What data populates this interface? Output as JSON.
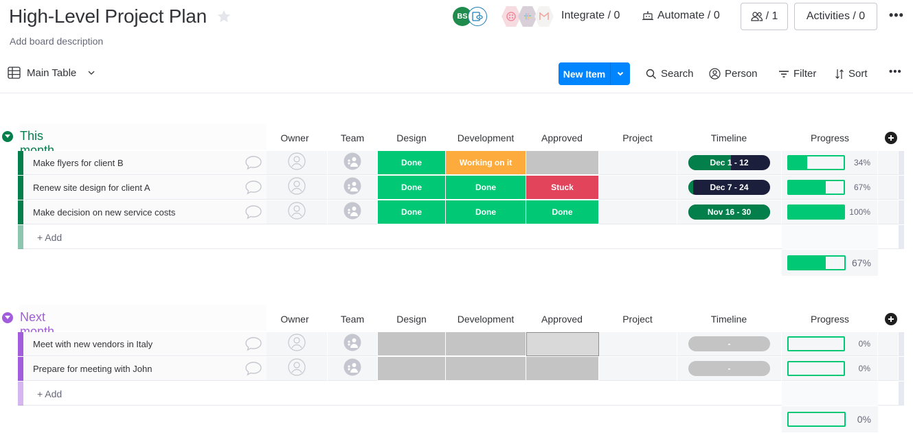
{
  "board": {
    "title": "High-Level Project Plan",
    "description": "Add board description"
  },
  "header": {
    "avatar_initials": "BS",
    "integrate_label": "Integrate / 0",
    "automate_label": "Automate / 0",
    "members_label": "/ 1",
    "activities_label": "Activities / 0",
    "more_label": "•••"
  },
  "toolbar": {
    "view_label": "Main Table",
    "new_item_label": "New Item",
    "search_label": "Search",
    "person_label": "Person",
    "filter_label": "Filter",
    "sort_label": "Sort",
    "more_label": "•••"
  },
  "columns": [
    "Owner",
    "Team",
    "Design",
    "Development",
    "Approved",
    "Project",
    "Timeline",
    "Progress"
  ],
  "status_colors": {
    "Done": "#00c875",
    "Working on it": "#fdab3d",
    "Stuck": "#e2445c",
    "": "#c4c4c4"
  },
  "groups": [
    {
      "title": "This month",
      "color": "#037f4c",
      "add_label": "+ Add",
      "items": [
        {
          "name": "Make flyers for client B",
          "design": "Done",
          "development": "Working on it",
          "approved": "",
          "timeline": "Dec 1 - 12",
          "timeline_elapsed": 0.52,
          "progress": 34,
          "progress_label": "34%"
        },
        {
          "name": "Renew site design for client A",
          "design": "Done",
          "development": "Done",
          "approved": "Stuck",
          "timeline": "Dec 7 - 24",
          "timeline_elapsed": 0.06,
          "progress": 67,
          "progress_label": "67%"
        },
        {
          "name": "Make decision on new service costs",
          "design": "Done",
          "development": "Done",
          "approved": "Done",
          "timeline": "Nov 16 - 30",
          "timeline_elapsed": 1.0,
          "progress": 100,
          "progress_label": "100%"
        }
      ],
      "summary_progress": 67,
      "summary_label": "67%"
    },
    {
      "title": "Next month",
      "color": "#a25ddc",
      "add_label": "+ Add",
      "items": [
        {
          "name": "Meet with new vendors in Italy",
          "design": "",
          "development": "",
          "approved": "",
          "timeline": "-",
          "timeline_elapsed": null,
          "progress": 0,
          "progress_label": "0%"
        },
        {
          "name": "Prepare for meeting with John",
          "design": "",
          "development": "",
          "approved": "",
          "timeline": "-",
          "timeline_elapsed": null,
          "progress": 0,
          "progress_label": "0%"
        }
      ],
      "summary_progress": 0,
      "summary_label": "0%"
    }
  ]
}
